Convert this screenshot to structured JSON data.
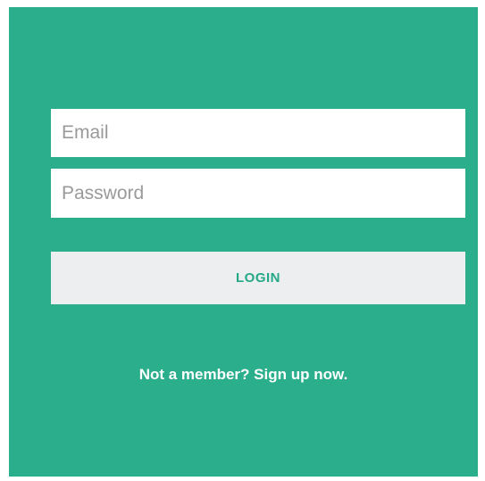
{
  "colors": {
    "background": "#2aae8c",
    "field_background": "#ffffff",
    "button_background": "#eceef0",
    "button_text": "#25a888",
    "link_text": "#ffffff"
  },
  "form": {
    "email_placeholder": "Email",
    "email_value": "",
    "password_placeholder": "Password",
    "password_value": "",
    "login_label": "LOGIN",
    "signup_text": "Not a member? Sign up now."
  }
}
